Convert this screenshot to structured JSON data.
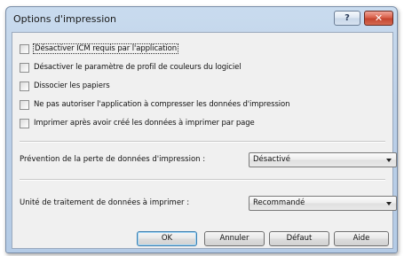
{
  "window": {
    "title": "Options d'impression",
    "help_label": "?",
    "close_label": "✕"
  },
  "checkboxes": [
    {
      "label": "Désactiver ICM requis par l'application",
      "checked": false,
      "focused": true
    },
    {
      "label": "Désactiver le paramètre de profil de couleurs du logiciel",
      "checked": false
    },
    {
      "label": "Dissocier les papiers",
      "checked": false
    },
    {
      "label": "Ne pas autoriser l'application à compresser les données d'impression",
      "checked": false
    },
    {
      "label": "Imprimer après avoir créé les données à imprimer par page",
      "checked": false
    }
  ],
  "fields": {
    "loss_prevention": {
      "label": "Prévention de la perte de données d'impression :",
      "value": "Désactivé"
    },
    "processing_unit": {
      "label": "Unité de traitement de données à imprimer :",
      "value": "Recommandé"
    }
  },
  "buttons": {
    "ok": "OK",
    "cancel": "Annuler",
    "defaults": "Défaut",
    "help": "Aide"
  }
}
